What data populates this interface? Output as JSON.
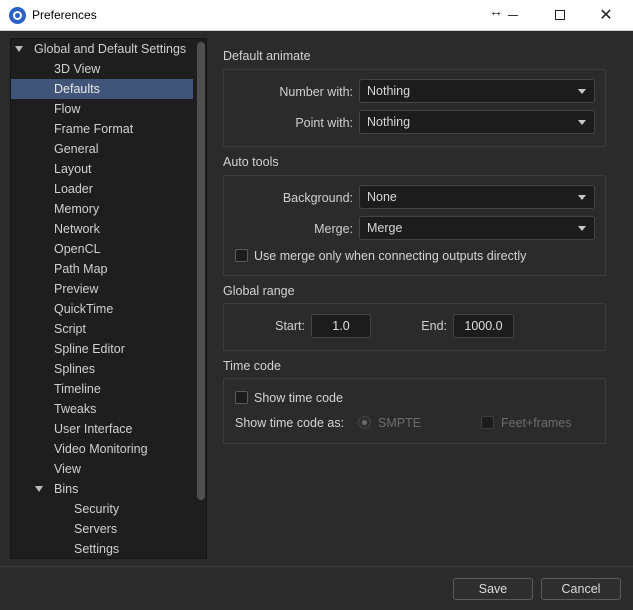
{
  "window": {
    "title": "Preferences",
    "resize_glyph": "↔",
    "close_glyph": "✕"
  },
  "tree": {
    "root": "Global and Default Settings",
    "items": [
      "3D View",
      "Defaults",
      "Flow",
      "Frame Format",
      "General",
      "Layout",
      "Loader",
      "Memory",
      "Network",
      "OpenCL",
      "Path Map",
      "Preview",
      "QuickTime",
      "Script",
      "Spline Editor",
      "Splines",
      "Timeline",
      "Tweaks",
      "User Interface",
      "Video Monitoring",
      "View"
    ],
    "selected": "Defaults",
    "bins": {
      "label": "Bins",
      "children": [
        "Security",
        "Servers",
        "Settings"
      ]
    }
  },
  "default_animate": {
    "title": "Default animate",
    "number_label": "Number with:",
    "number_value": "Nothing",
    "point_label": "Point with:",
    "point_value": "Nothing"
  },
  "auto_tools": {
    "title": "Auto tools",
    "background_label": "Background:",
    "background_value": "None",
    "merge_label": "Merge:",
    "merge_value": "Merge",
    "merge_checkbox_label": "Use merge only when connecting outputs directly",
    "merge_checkbox_checked": false
  },
  "global_range": {
    "title": "Global range",
    "start_label": "Start:",
    "start_value": "1.0",
    "end_label": "End:",
    "end_value": "1000.0"
  },
  "time_code": {
    "title": "Time code",
    "show_label": "Show time code",
    "show_checked": false,
    "as_label": "Show time code as:",
    "option_smpte": "SMPTE",
    "option_feet": "Feet+frames",
    "selected_option": "SMPTE"
  },
  "footer": {
    "save_label": "Save",
    "cancel_label": "Cancel"
  },
  "colors": {
    "background": "#2b2b2b",
    "panel": "#1e1e1e",
    "selection": "#41557a",
    "brand": "#2b62c8"
  },
  "icons": {
    "app": "fusion-logo-icon",
    "resize": "resize-arrows-icon",
    "minimize": "minimize-icon",
    "maximize": "maximize-icon",
    "close": "close-icon",
    "dropdown": "chevron-down-icon",
    "expand": "triangle-down-icon"
  }
}
